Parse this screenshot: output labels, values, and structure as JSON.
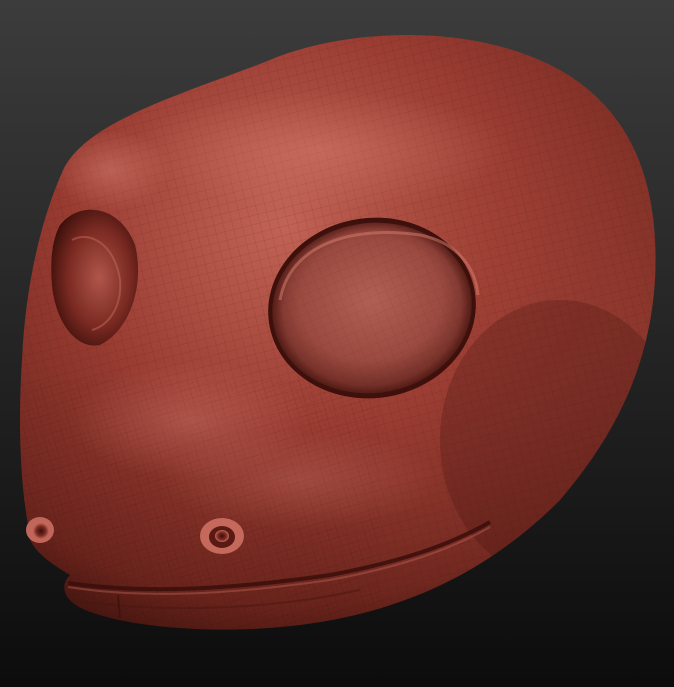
{
  "viewport": {
    "background_top": "#3c3c3c",
    "background_bottom": "#0c0c0c"
  },
  "model": {
    "material_base": "#9a3c32",
    "material_light": "#c8675a",
    "material_dark": "#4a1712",
    "wireframe_color": "#2a0a08",
    "icon_name": "sculpt-head-model"
  }
}
